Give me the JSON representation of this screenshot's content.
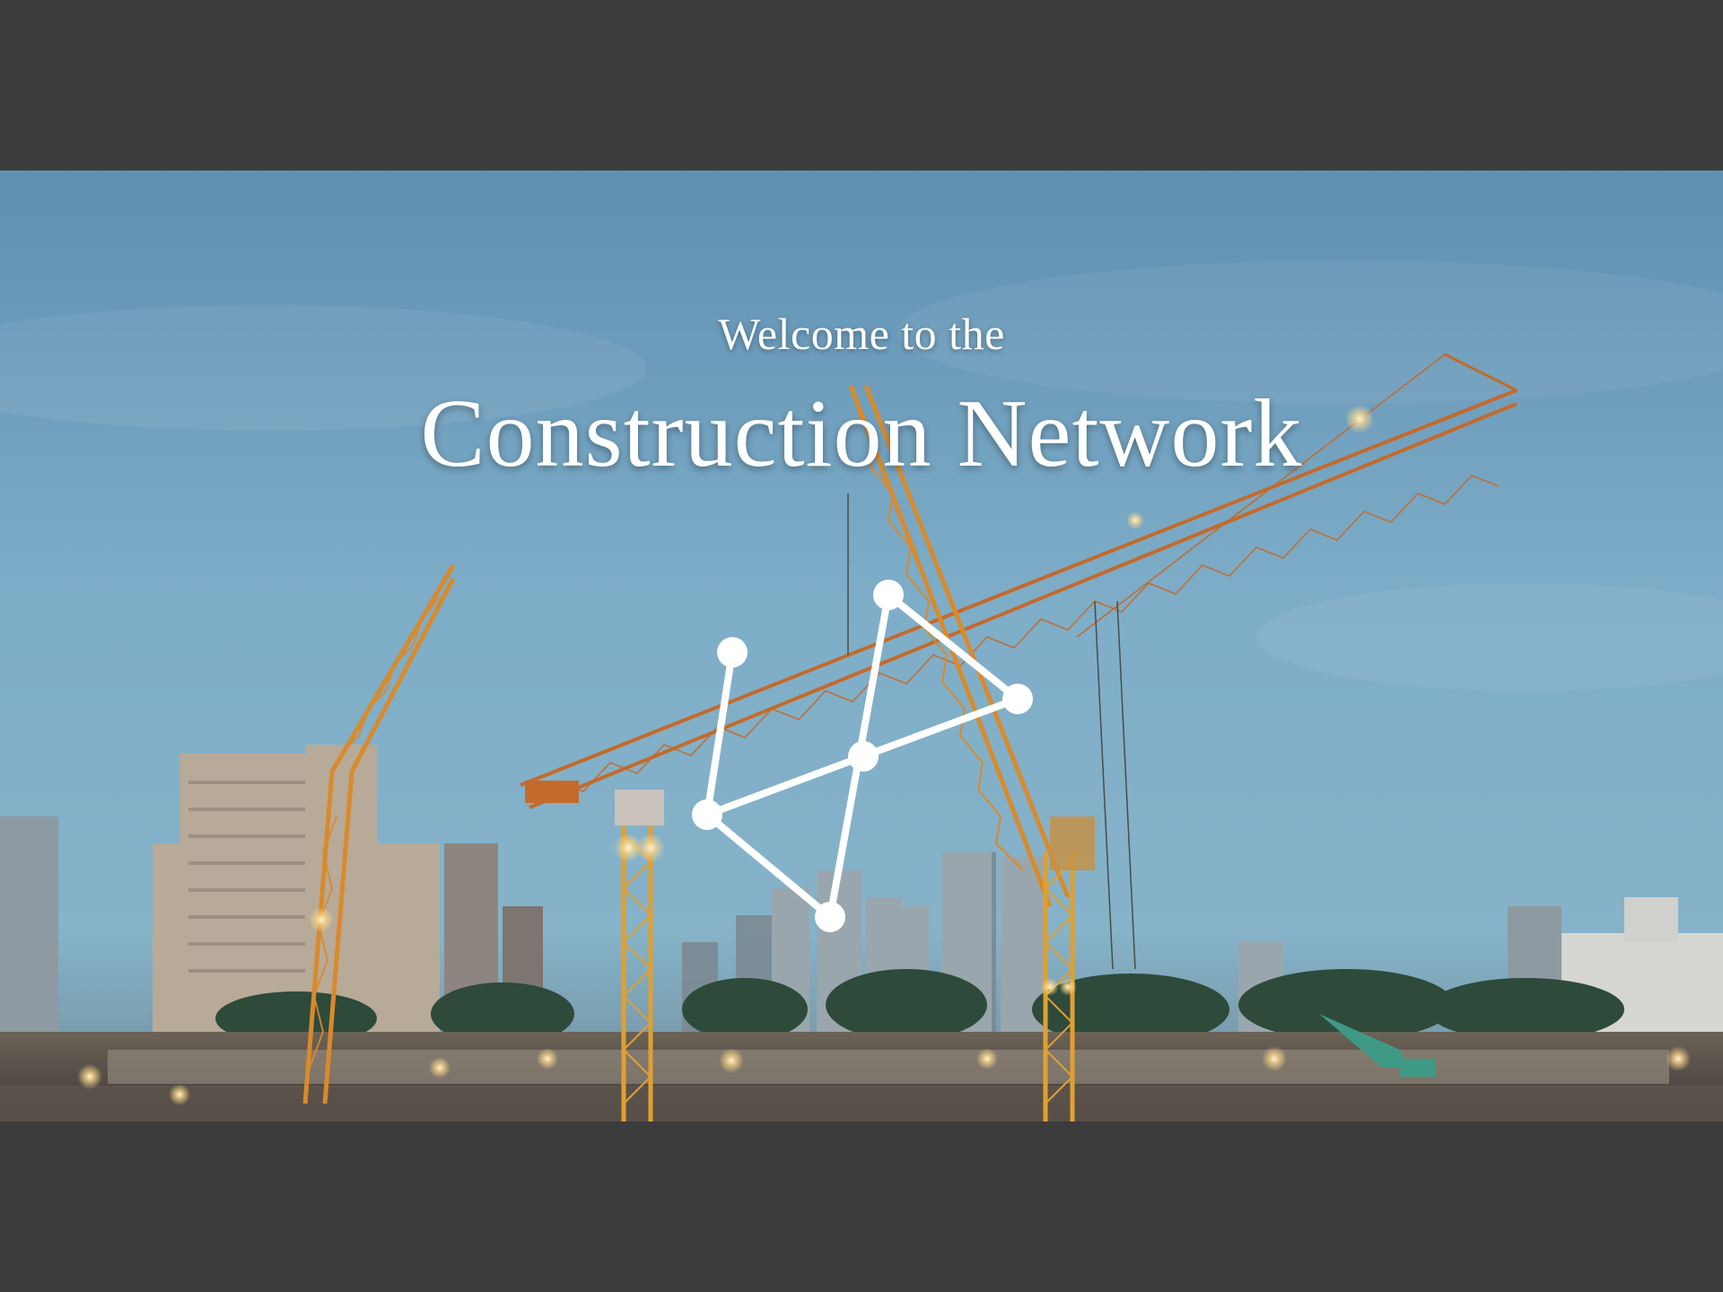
{
  "hero": {
    "welcome_text": "Welcome to the",
    "title_text": "Construction Network",
    "logo_icon": "network-nodes-icon",
    "background": "construction-site-cranes-skyline-dusk"
  },
  "colors": {
    "letterbox": "#3c3c3c",
    "sky_top": "#5e8fb0",
    "sky_bottom": "#8ab6cf",
    "text": "#ffffff",
    "crane": "#d98a2b"
  }
}
